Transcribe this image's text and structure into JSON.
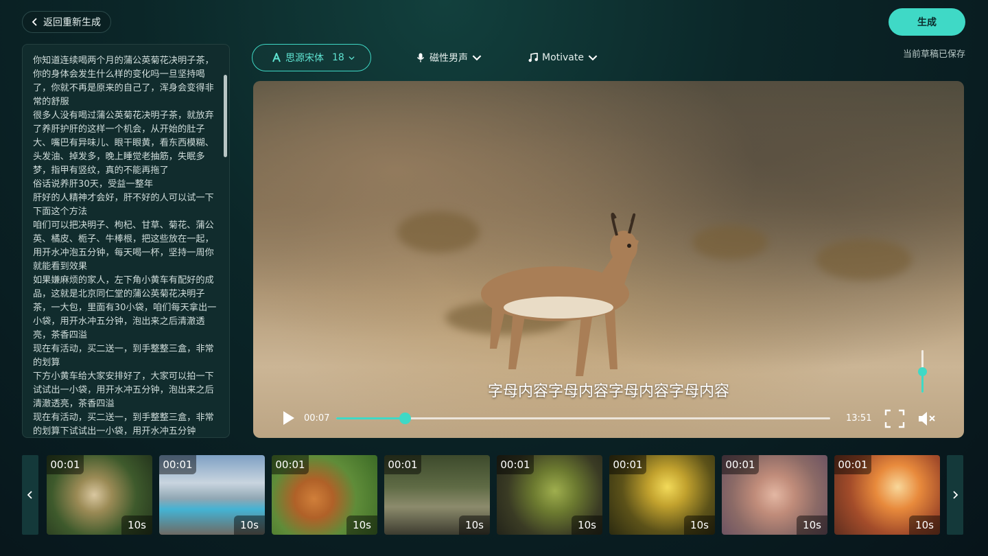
{
  "header": {
    "back_label": "返回重新生成",
    "generate_label": "生成",
    "saved_status": "当前草稿已保存"
  },
  "script": {
    "text": "你知道连续喝两个月的蒲公英菊花决明子茶，你的身体会发生什么样的变化吗一旦坚持喝了，你就不再是原来的自己了，浑身会变得非常的舒服\n很多人没有喝过蒲公英菊花决明子茶，就放弃了养肝护肝的这样一个机会，从开始的肚子大、嘴巴有异味儿、眼干眼黄，看东西模糊、头发油、掉发多，晚上睡觉老抽筋，失眠多梦，指甲有竖纹，真的不能再拖了\n俗话说养肝30天，受益一整年\n肝好的人精神才会好，肝不好的人可以试一下下面这个方法\n咱们可以把决明子、枸杞、甘草、菊花、蒲公英、橘皮、栀子、牛棒根，把这些放在一起，用开水冲泡五分钟，每天喝一杯，坚持一周你就能看到效果\n如果嫌麻烦的家人，左下角小黄车有配好的成品，这就是北京同仁堂的蒲公英菊花决明子茶，一大包，里面有30小袋，咱们每天拿出一小袋，用开水冲五分钟，泡出来之后清澈透亮，茶香四溢\n现在有活动，买二送一，到手整整三盒，非常的划算\n下方小黄车给大家安排好了，大家可以拍一下试试出一小袋，用开水冲五分钟，泡出来之后清澈透亮，茶香四溢\n现在有活动，买二送一，到手整整三盒，非常的划算下试试出一小袋，用开水冲五分钟"
  },
  "toolbar": {
    "font_name": "思源宋体",
    "font_size": "18",
    "voice_label": "磁性男声",
    "music_label": "Motivate"
  },
  "player": {
    "subtitle": "字母内容字母内容字母内容字母内容",
    "current_time": "00:07",
    "total_time": "13:51",
    "progress_fraction": 0.139,
    "volume_fraction": 0.48
  },
  "clips": [
    {
      "start": "00:01",
      "duration": "10s"
    },
    {
      "start": "00:01",
      "duration": "10s"
    },
    {
      "start": "00:01",
      "duration": "10s"
    },
    {
      "start": "00:01",
      "duration": "10s"
    },
    {
      "start": "00:01",
      "duration": "10s"
    },
    {
      "start": "00:01",
      "duration": "10s"
    },
    {
      "start": "00:01",
      "duration": "10s"
    },
    {
      "start": "00:01",
      "duration": "10s"
    }
  ],
  "colors": {
    "accent": "#3fd9c6",
    "panel": "#112c2d",
    "background": "#07141a"
  },
  "icons": {
    "back": "chevron-left-icon",
    "font": "font-a-icon",
    "voice": "microphone-icon",
    "music": "music-note-icon",
    "play": "play-icon",
    "fullscreen": "fullscreen-icon",
    "mute": "mute-icon",
    "prev": "chevron-left-icon",
    "next": "chevron-right-icon"
  }
}
